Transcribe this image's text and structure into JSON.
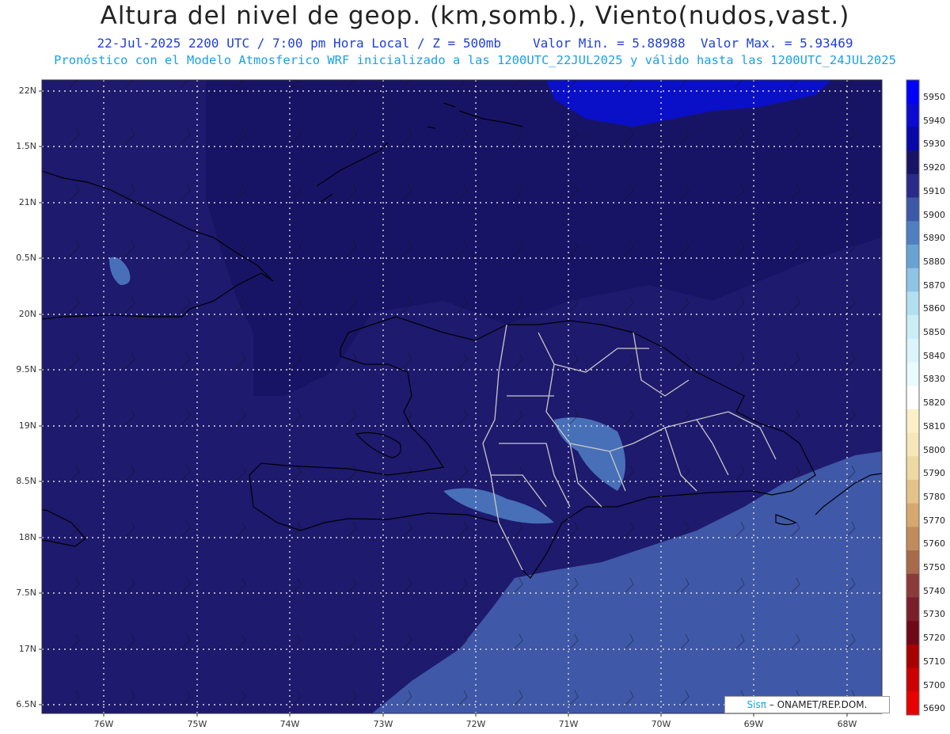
{
  "header": {
    "title": "Altura del nivel de geop. (km,somb.), Viento(nudos,vast.)",
    "date_time": "22-Jul-2025  2200 UTC / 7:00 pm Hora Local / Z = 500mb",
    "min_label": "Valor Min. = 5.88988",
    "max_label": "Valor Max. = 5.93469",
    "model_info": "Pronóstico con el Modelo Atmosferico WRF inicializado a las 1200UTC_22JUL2025 y válido hasta las  1200UTC_24JUL2025"
  },
  "axes": {
    "lat_labels": [
      "22N",
      "1.5N",
      "21N",
      "0.5N",
      "20N",
      "9.5N",
      "19N",
      "8.5N",
      "18N",
      "7.5N",
      "17N",
      "6.5N"
    ],
    "lon_labels": [
      "76W",
      "75W",
      "74W",
      "73W",
      "72W",
      "71W",
      "70W",
      "69W",
      "68W"
    ]
  },
  "colorbar": {
    "labels": [
      "5950",
      "5940",
      "5930",
      "5920",
      "5910",
      "5900",
      "5890",
      "5880",
      "5870",
      "5860",
      "5850",
      "5840",
      "5830",
      "5820",
      "5810",
      "5800",
      "5790",
      "5780",
      "5770",
      "5760",
      "5750",
      "5740",
      "5730",
      "5720",
      "5710",
      "5700",
      "5690"
    ],
    "colors": [
      "#0000ff",
      "#0a0ad0",
      "#0808a8",
      "#181465",
      "#2a2a8a",
      "#3e58a8",
      "#4f7fc0",
      "#69a3d4",
      "#8ec4e6",
      "#b3e0f0",
      "#c9eef6",
      "#dcf5fa",
      "#e8fbfd",
      "#ffffff",
      "#fbf0c8",
      "#f6e6b8",
      "#efd9a2",
      "#e4c28a",
      "#d6a870",
      "#c28b5c",
      "#a86a4a",
      "#8c3a3a",
      "#7a1f2a",
      "#700818",
      "#a80000",
      "#cc0000",
      "#e80000"
    ]
  },
  "legend_colors": {
    "ocean": "#1e1a6e",
    "north_dark": "#181465",
    "max_area": "#0a10c8",
    "south_light": "#3f58a8",
    "patch": "#4870b8"
  },
  "credit": {
    "brand": "Sisπ",
    "text": "– ONAMET/REP.DOM."
  }
}
